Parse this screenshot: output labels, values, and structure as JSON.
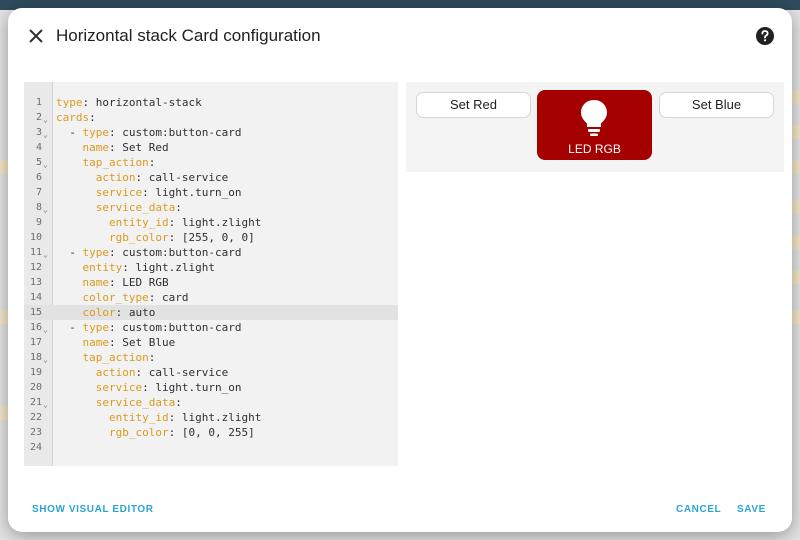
{
  "dialog": {
    "title": "Horizontal stack Card configuration"
  },
  "editor": {
    "lines": [
      {
        "n": "1",
        "fold": false,
        "key": "type",
        "sep": ": ",
        "val": "horizontal-stack",
        "indent": ""
      },
      {
        "n": "2",
        "fold": true,
        "key": "cards",
        "sep": ":",
        "val": "",
        "indent": ""
      },
      {
        "n": "3",
        "fold": true,
        "key": "type",
        "sep": ": ",
        "val": "custom:button-card",
        "indent": "  - "
      },
      {
        "n": "4",
        "fold": false,
        "key": "name",
        "sep": ": ",
        "val": "Set Red",
        "indent": "    "
      },
      {
        "n": "5",
        "fold": true,
        "key": "tap_action",
        "sep": ":",
        "val": "",
        "indent": "    "
      },
      {
        "n": "6",
        "fold": false,
        "key": "action",
        "sep": ": ",
        "val": "call-service",
        "indent": "      "
      },
      {
        "n": "7",
        "fold": false,
        "key": "service",
        "sep": ": ",
        "val": "light.turn_on",
        "indent": "      "
      },
      {
        "n": "8",
        "fold": true,
        "key": "service_data",
        "sep": ":",
        "val": "",
        "indent": "      "
      },
      {
        "n": "9",
        "fold": false,
        "key": "entity_id",
        "sep": ": ",
        "val": "light.zlight",
        "indent": "        "
      },
      {
        "n": "10",
        "fold": false,
        "key": "rgb_color",
        "sep": ": ",
        "val": "[255, 0, 0]",
        "indent": "        "
      },
      {
        "n": "11",
        "fold": true,
        "key": "type",
        "sep": ": ",
        "val": "custom:button-card",
        "indent": "  - "
      },
      {
        "n": "12",
        "fold": false,
        "key": "entity",
        "sep": ": ",
        "val": "light.zlight",
        "indent": "    "
      },
      {
        "n": "13",
        "fold": false,
        "key": "name",
        "sep": ": ",
        "val": "LED RGB",
        "indent": "    "
      },
      {
        "n": "14",
        "fold": false,
        "key": "color_type",
        "sep": ": ",
        "val": "card",
        "indent": "    "
      },
      {
        "n": "15",
        "fold": false,
        "key": "color",
        "sep": ": ",
        "val": "auto",
        "indent": "    ",
        "active": true
      },
      {
        "n": "16",
        "fold": true,
        "key": "type",
        "sep": ": ",
        "val": "custom:button-card",
        "indent": "  - "
      },
      {
        "n": "17",
        "fold": false,
        "key": "name",
        "sep": ": ",
        "val": "Set Blue",
        "indent": "    "
      },
      {
        "n": "18",
        "fold": true,
        "key": "tap_action",
        "sep": ":",
        "val": "",
        "indent": "    "
      },
      {
        "n": "19",
        "fold": false,
        "key": "action",
        "sep": ": ",
        "val": "call-service",
        "indent": "      "
      },
      {
        "n": "20",
        "fold": false,
        "key": "service",
        "sep": ": ",
        "val": "light.turn_on",
        "indent": "      "
      },
      {
        "n": "21",
        "fold": true,
        "key": "service_data",
        "sep": ":",
        "val": "",
        "indent": "      "
      },
      {
        "n": "22",
        "fold": false,
        "key": "entity_id",
        "sep": ": ",
        "val": "light.zlight",
        "indent": "        "
      },
      {
        "n": "23",
        "fold": false,
        "key": "rgb_color",
        "sep": ": ",
        "val": "[0, 0, 255]",
        "indent": "        "
      },
      {
        "n": "24",
        "fold": false,
        "key": "",
        "sep": "",
        "val": "",
        "indent": ""
      }
    ]
  },
  "preview": {
    "set_red_label": "Set Red",
    "led_label": "LED RGB",
    "set_blue_label": "Set Blue",
    "led_color": "#a50000",
    "icon": "lightbulb-icon"
  },
  "footer": {
    "visual_editor_label": "SHOW VISUAL EDITOR",
    "cancel_label": "CANCEL",
    "save_label": "SAVE"
  },
  "colors": {
    "accent": "#2aa4d3",
    "yaml_key": "#d89b1f"
  }
}
